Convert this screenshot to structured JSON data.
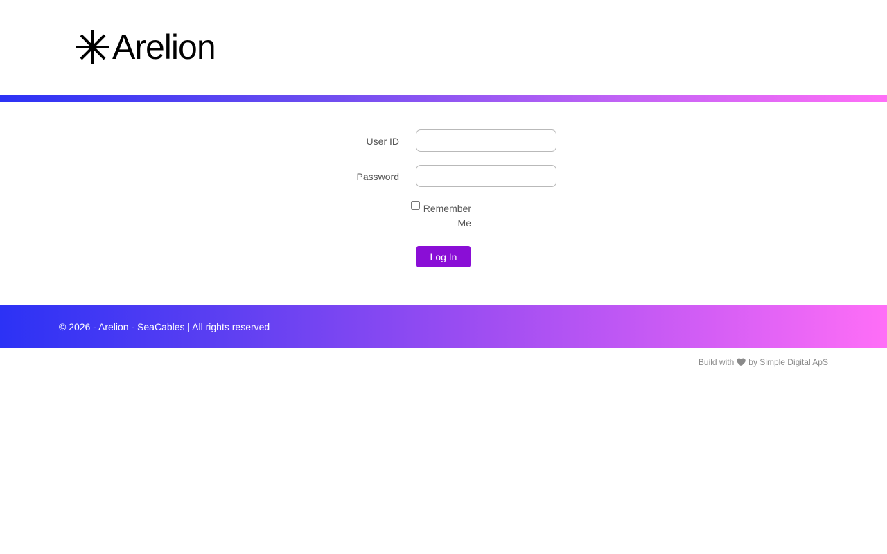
{
  "header": {
    "logo_text": "Arelion",
    "logo_alt": "Arelion logo"
  },
  "form": {
    "userid_label": "User ID",
    "userid_value": "",
    "password_label": "Password",
    "password_value": "",
    "remember_label": "Remember Me",
    "remember_checked": false,
    "login_button_label": "Log In"
  },
  "footer": {
    "copyright": "© 2026 - Arelion - SeaCables | All rights reserved"
  },
  "credits": {
    "prefix": "Build with",
    "suffix": "by Simple Digital ApS",
    "icon": "heart-icon"
  },
  "colors": {
    "brand_purple": "#8a0ed6",
    "gradient_start": "#2c32f5",
    "gradient_end": "#ff6ef7"
  }
}
